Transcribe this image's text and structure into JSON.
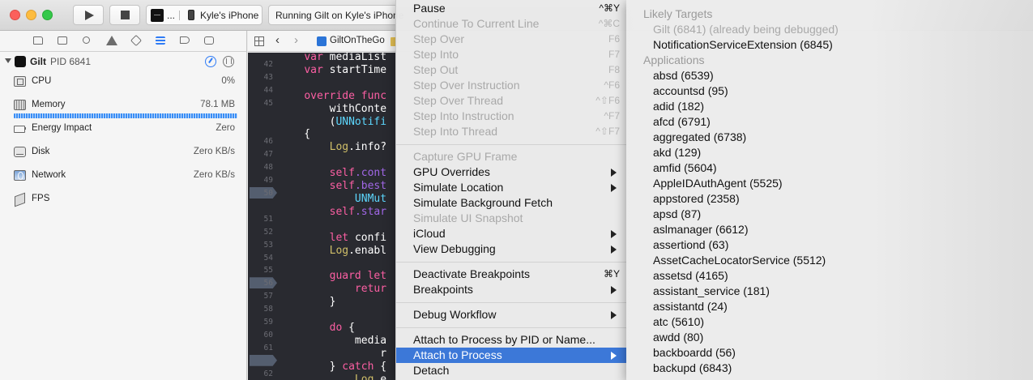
{
  "toolbar": {
    "scheme_app_label": "...",
    "device_label": "Kyle's iPhone",
    "activity_text": "Running Gilt on Kyle's iPhone"
  },
  "navigator": {
    "process": {
      "name": "Gilt",
      "pid": "PID 6841"
    },
    "gauges": [
      {
        "label": "CPU",
        "value": "0%"
      },
      {
        "label": "Memory",
        "value": "78.1 MB"
      },
      {
        "label": "Energy Impact",
        "value": "Zero"
      },
      {
        "label": "Disk",
        "value": "Zero KB/s"
      },
      {
        "label": "Network",
        "value": "Zero KB/s"
      },
      {
        "label": "FPS",
        "value": ""
      }
    ]
  },
  "jumpbar": {
    "project": "GiltOnTheGo"
  },
  "editor": {
    "line_numbers": [
      "42",
      "43",
      "44",
      "45",
      "",
      "",
      "46",
      "47",
      "48",
      "49",
      "50",
      "",
      "51",
      "52",
      "53",
      "54",
      "55",
      "56",
      "57",
      "58",
      "59",
      "60",
      "61",
      "",
      "62",
      "63"
    ],
    "code_lines": [
      [
        {
          "t": "    ",
          "c": "#ffffff"
        },
        {
          "t": "var ",
          "c": "#fc5fa3"
        },
        {
          "t": "mediaList",
          "c": "#ffffff"
        }
      ],
      [
        {
          "t": "    ",
          "c": "#ffffff"
        },
        {
          "t": "var ",
          "c": "#fc5fa3"
        },
        {
          "t": "startTime",
          "c": "#ffffff"
        }
      ],
      [],
      [
        {
          "t": "    ",
          "c": "#ffffff"
        },
        {
          "t": "override func",
          "c": "#fc5fa3"
        }
      ],
      [
        {
          "t": "        withConte",
          "c": "#ffffff"
        }
      ],
      [
        {
          "t": "        (",
          "c": "#ffffff"
        },
        {
          "t": "UNNotifi",
          "c": "#5dd8ff"
        }
      ],
      [
        {
          "t": "    {",
          "c": "#ffffff"
        }
      ],
      [
        {
          "t": "        ",
          "c": "#ffffff"
        },
        {
          "t": "Log",
          "c": "#d0bf69"
        },
        {
          "t": ".info?",
          "c": "#ffffff"
        }
      ],
      [],
      [
        {
          "t": "        ",
          "c": "#ffffff"
        },
        {
          "t": "self",
          "c": "#fc5fa3"
        },
        {
          "t": ".cont",
          "c": "#a167e6"
        }
      ],
      [
        {
          "t": "        ",
          "c": "#ffffff"
        },
        {
          "t": "self",
          "c": "#fc5fa3"
        },
        {
          "t": ".best",
          "c": "#a167e6"
        }
      ],
      [
        {
          "t": "            ",
          "c": "#ffffff"
        },
        {
          "t": "UNMut",
          "c": "#5dd8ff"
        }
      ],
      [
        {
          "t": "        ",
          "c": "#ffffff"
        },
        {
          "t": "self",
          "c": "#fc5fa3"
        },
        {
          "t": ".star",
          "c": "#a167e6"
        }
      ],
      [],
      [
        {
          "t": "        ",
          "c": "#ffffff"
        },
        {
          "t": "let ",
          "c": "#fc5fa3"
        },
        {
          "t": "confi",
          "c": "#ffffff"
        }
      ],
      [
        {
          "t": "        ",
          "c": "#ffffff"
        },
        {
          "t": "Log",
          "c": "#d0bf69"
        },
        {
          "t": ".enabl",
          "c": "#ffffff"
        }
      ],
      [],
      [
        {
          "t": "        ",
          "c": "#ffffff"
        },
        {
          "t": "guard let",
          "c": "#fc5fa3"
        }
      ],
      [
        {
          "t": "            ",
          "c": "#ffffff"
        },
        {
          "t": "retur",
          "c": "#fc5fa3"
        }
      ],
      [
        {
          "t": "        }",
          "c": "#ffffff"
        }
      ],
      [],
      [
        {
          "t": "        ",
          "c": "#ffffff"
        },
        {
          "t": "do ",
          "c": "#fc5fa3"
        },
        {
          "t": "{",
          "c": "#ffffff"
        }
      ],
      [
        {
          "t": "            media",
          "c": "#ffffff"
        }
      ],
      [
        {
          "t": "                r",
          "c": "#ffffff"
        }
      ],
      [
        {
          "t": "        } ",
          "c": "#ffffff"
        },
        {
          "t": "catch",
          "c": "#fc5fa3"
        },
        {
          "t": " {",
          "c": "#ffffff"
        }
      ],
      [
        {
          "t": "            ",
          "c": "#ffffff"
        },
        {
          "t": "Log",
          "c": "#d0bf69"
        },
        {
          "t": ".e",
          "c": "#ffffff"
        }
      ]
    ]
  },
  "debug_menu": {
    "items": [
      {
        "label": "Pause",
        "shortcut": "^⌘Y",
        "disabled": false,
        "submenu": false
      },
      {
        "label": "Continue To Current Line",
        "shortcut": "^⌘C",
        "disabled": true,
        "submenu": false
      },
      {
        "label": "Step Over",
        "shortcut": "F6",
        "disabled": true,
        "submenu": false
      },
      {
        "label": "Step Into",
        "shortcut": "F7",
        "disabled": true,
        "submenu": false
      },
      {
        "label": "Step Out",
        "shortcut": "F8",
        "disabled": true,
        "submenu": false
      },
      {
        "label": "Step Over Instruction",
        "shortcut": "^F6",
        "disabled": true,
        "submenu": false
      },
      {
        "label": "Step Over Thread",
        "shortcut": "^⇧F6",
        "disabled": true,
        "submenu": false
      },
      {
        "label": "Step Into Instruction",
        "shortcut": "^F7",
        "disabled": true,
        "submenu": false
      },
      {
        "label": "Step Into Thread",
        "shortcut": "^⇧F7",
        "disabled": true,
        "submenu": false
      },
      {
        "separator": true
      },
      {
        "label": "Capture GPU Frame",
        "shortcut": "",
        "disabled": true,
        "submenu": false
      },
      {
        "label": "GPU Overrides",
        "shortcut": "",
        "disabled": false,
        "submenu": true
      },
      {
        "label": "Simulate Location",
        "shortcut": "",
        "disabled": false,
        "submenu": true
      },
      {
        "label": "Simulate Background Fetch",
        "shortcut": "",
        "disabled": false,
        "submenu": false
      },
      {
        "label": "Simulate UI Snapshot",
        "shortcut": "",
        "disabled": true,
        "submenu": false
      },
      {
        "label": "iCloud",
        "shortcut": "",
        "disabled": false,
        "submenu": true
      },
      {
        "label": "View Debugging",
        "shortcut": "",
        "disabled": false,
        "submenu": true
      },
      {
        "separator": true
      },
      {
        "label": "Deactivate Breakpoints",
        "shortcut": "⌘Y",
        "disabled": false,
        "submenu": false
      },
      {
        "label": "Breakpoints",
        "shortcut": "",
        "disabled": false,
        "submenu": true
      },
      {
        "separator": true
      },
      {
        "label": "Debug Workflow",
        "shortcut": "",
        "disabled": false,
        "submenu": true
      },
      {
        "separator": true
      },
      {
        "label": "Attach to Process by PID or Name...",
        "shortcut": "",
        "disabled": false,
        "submenu": false
      },
      {
        "label": "Attach to Process",
        "shortcut": "",
        "disabled": false,
        "submenu": true,
        "selected": true
      },
      {
        "label": "Detach",
        "shortcut": "",
        "disabled": false,
        "submenu": false
      }
    ]
  },
  "attach_submenu": {
    "likely_targets_header": "Likely Targets",
    "likely_targets": [
      {
        "label": "Gilt (6841) (already being debugged)",
        "disabled": true
      },
      {
        "label": "NotificationServiceExtension (6845)",
        "disabled": false
      }
    ],
    "applications_header": "Applications",
    "applications": [
      "absd (6539)",
      "accountsd (95)",
      "adid (182)",
      "afcd (6791)",
      "aggregated (6738)",
      "akd (129)",
      "amfid (5604)",
      "AppleIDAuthAgent (5525)",
      "appstored (2358)",
      "apsd (87)",
      "aslmanager (6612)",
      "assertiond (63)",
      "AssetCacheLocatorService (5512)",
      "assetsd (4165)",
      "assistant_service (181)",
      "assistantd (24)",
      "atc (5610)",
      "awdd (80)",
      "backboardd (56)",
      "backupd (6843)"
    ]
  }
}
